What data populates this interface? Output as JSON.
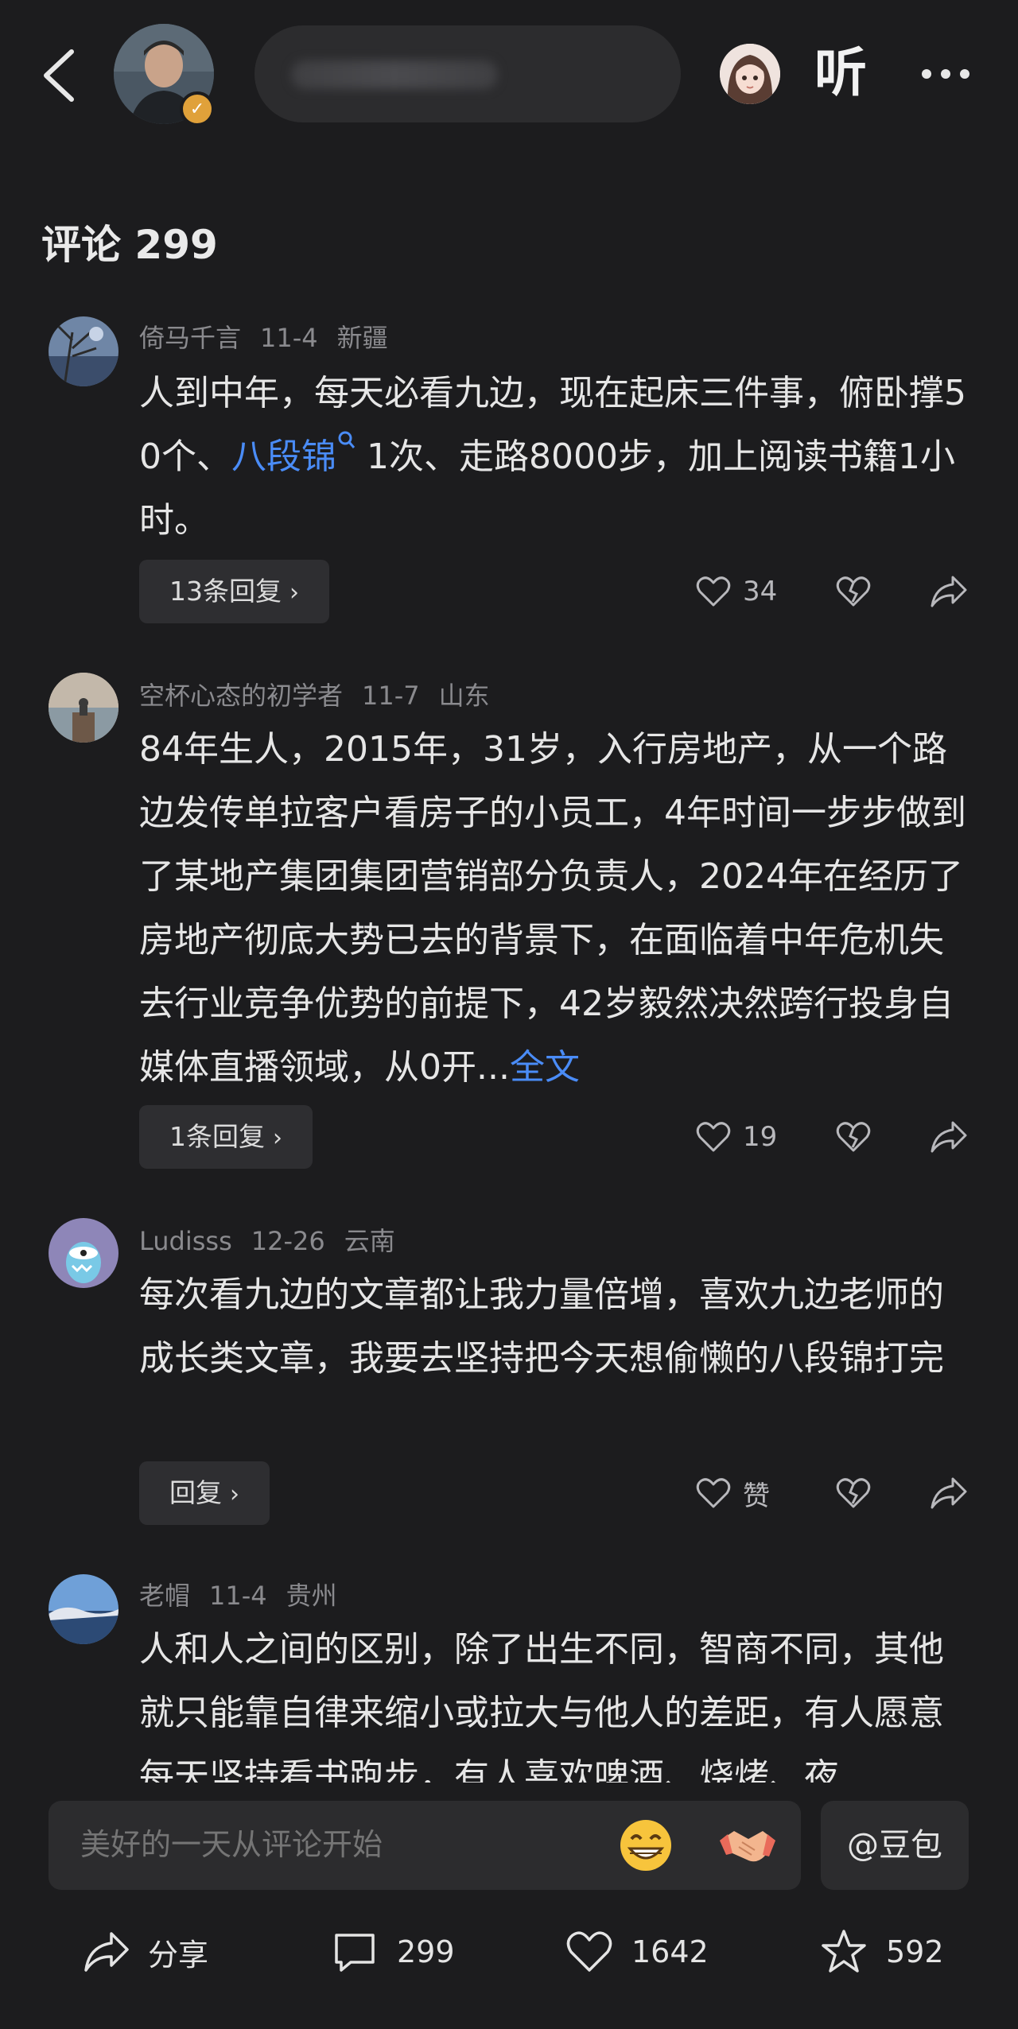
{
  "header": {
    "listen_label": "听"
  },
  "comments_section": {
    "title": "评论 299"
  },
  "comments": [
    {
      "user": "倚马千言",
      "date": "11-4",
      "location": "新疆",
      "text_before": "人到中年，每天必看九边，现在起床三件事，俯卧撑50个、",
      "link_text": "八段锦",
      "text_after": " 1次、走路8000步，加上阅读书籍1小时。",
      "reply_label": "13条回复",
      "likes": "34"
    },
    {
      "user": "空杯心态的初学者",
      "date": "11-7",
      "location": "山东",
      "text": "84年生人，2015年，31岁，入行房地产，从一个路边发传单拉客户看房子的小员工，4年时间一步步做到了某地产集团集团营销部分负责人，2024年在经历了房地产彻底大势已去的背景下，在面临着中年危机失去行业竞争优势的前提下，42岁毅然决然跨行投身自媒体直播领域，从0开...",
      "full_text_link": "全文",
      "reply_label": "1条回复",
      "likes": "19"
    },
    {
      "user": "Ludisss",
      "date": "12-26",
      "location": "云南",
      "text": "每次看九边的文章都让我力量倍增，喜欢九边老师的成长类文章，我要去坚持把今天想偷懒的八段锦打完",
      "reply_label": "回复",
      "likes": "赞"
    },
    {
      "user": "老帽",
      "date": "11-4",
      "location": "贵州",
      "text": "人和人之间的区别，除了出生不同，智商不同，其他就只能靠自律来缩小或拉大与他人的差距，有人愿意每天坚持看书跑步，有人喜欢啤酒、烧烤、夜"
    }
  ],
  "input_bar": {
    "placeholder": "美好的一天从评论开始",
    "doubao_label": "@豆包"
  },
  "bottom_bar": {
    "share_label": "分享",
    "comment_count": "299",
    "like_count": "1642",
    "favorite_count": "592"
  }
}
